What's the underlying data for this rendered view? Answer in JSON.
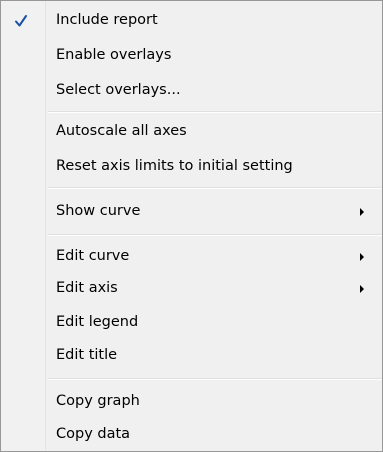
{
  "menu": {
    "items": [
      {
        "label": "Include report",
        "checked": true,
        "submenu": false
      },
      {
        "label": "Enable overlays",
        "checked": false,
        "submenu": false
      },
      {
        "label": "Select overlays...",
        "checked": false,
        "submenu": false
      },
      {
        "label": "Autoscale all axes",
        "checked": false,
        "submenu": false
      },
      {
        "label": "Reset axis limits to initial setting",
        "checked": false,
        "submenu": false
      },
      {
        "label": "Show curve",
        "checked": false,
        "submenu": true
      },
      {
        "label": "Edit curve",
        "checked": false,
        "submenu": true
      },
      {
        "label": "Edit axis",
        "checked": false,
        "submenu": true
      },
      {
        "label": "Edit legend",
        "checked": false,
        "submenu": false
      },
      {
        "label": "Edit title",
        "checked": false,
        "submenu": false
      },
      {
        "label": "Copy graph",
        "checked": false,
        "submenu": false
      },
      {
        "label": "Copy data",
        "checked": false,
        "submenu": false
      }
    ],
    "check_icon": "checkmark-icon",
    "submenu_icon": "submenu-arrow-icon",
    "colors": {
      "check": "#1a4fa3",
      "background": "#f0f0f0",
      "border": "#979797"
    }
  }
}
